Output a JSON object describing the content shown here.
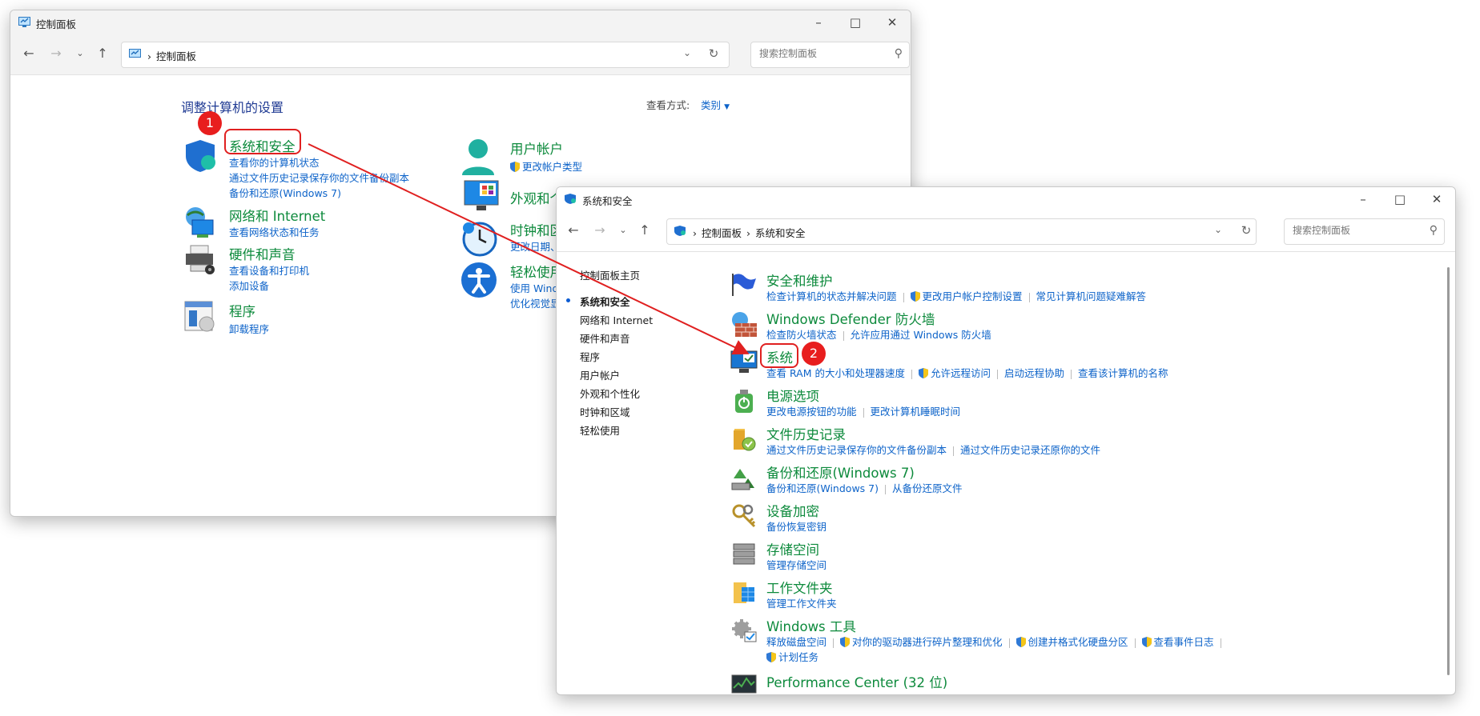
{
  "colors": {
    "accent": "#0d63c9",
    "category_green": "#0d8a3c",
    "heading_blue": "#1f3a93",
    "annotation_red": "#e02020"
  },
  "back_window": {
    "title": "控制面板",
    "breadcrumb": [
      "控制面板"
    ],
    "search_placeholder": "搜索控制面板",
    "heading": "调整计算机的设置",
    "view_by_label": "查看方式:",
    "view_by_value": "类别",
    "categories": [
      {
        "title": "系统和安全",
        "icon": "shield-icon",
        "links": [
          "查看你的计算机状态",
          "通过文件历史记录保存你的文件备份副本",
          "备份和还原(Windows 7)"
        ]
      },
      {
        "title": "网络和 Internet",
        "icon": "network-globe-icon",
        "links": [
          "查看网络状态和任务"
        ]
      },
      {
        "title": "硬件和声音",
        "icon": "printer-icon",
        "links": [
          "查看设备和打印机",
          "添加设备"
        ]
      },
      {
        "title": "程序",
        "icon": "programs-icon",
        "links": [
          "卸载程序"
        ]
      },
      {
        "title": "用户帐户",
        "icon": "user-icon",
        "links": [
          "更改帐户类型"
        ]
      },
      {
        "title": "外观和个",
        "icon": "appearance-icon",
        "links": []
      },
      {
        "title": "时钟和区",
        "icon": "clock-icon",
        "links": [
          "更改日期、"
        ]
      },
      {
        "title": "轻松使用",
        "icon": "accessibility-icon",
        "links": [
          "使用 Wind",
          "优化视觉显"
        ]
      }
    ]
  },
  "front_window": {
    "title": "系统和安全",
    "breadcrumb": [
      "控制面板",
      "系统和安全"
    ],
    "search_placeholder": "搜索控制面板",
    "sidebar": [
      {
        "label": "控制面板主页",
        "active": false
      },
      {
        "label": "系统和安全",
        "active": true
      },
      {
        "label": "网络和 Internet",
        "active": false
      },
      {
        "label": "硬件和声音",
        "active": false
      },
      {
        "label": "程序",
        "active": false
      },
      {
        "label": "用户帐户",
        "active": false
      },
      {
        "label": "外观和个性化",
        "active": false
      },
      {
        "label": "时钟和区域",
        "active": false
      },
      {
        "label": "轻松使用",
        "active": false
      }
    ],
    "sections": [
      {
        "title": "安全和维护",
        "icon": "flag-icon",
        "links": [
          "检查计算机的状态并解决问题",
          "更改用户帐户控制设置",
          "常见计算机问题疑难解答"
        ]
      },
      {
        "title": "Windows Defender 防火墙",
        "icon": "firewall-icon",
        "links": [
          "检查防火墙状态",
          "允许应用通过 Windows 防火墙"
        ]
      },
      {
        "title": "系统",
        "icon": "system-monitor-icon",
        "links": [
          "查看 RAM 的大小和处理器速度",
          "允许远程访问",
          "启动远程协助",
          "查看该计算机的名称"
        ]
      },
      {
        "title": "电源选项",
        "icon": "power-icon",
        "links": [
          "更改电源按钮的功能",
          "更改计算机睡眠时间"
        ]
      },
      {
        "title": "文件历史记录",
        "icon": "file-history-icon",
        "links": [
          "通过文件历史记录保存你的文件备份副本",
          "通过文件历史记录还原你的文件"
        ]
      },
      {
        "title": "备份和还原(Windows 7)",
        "icon": "backup-icon",
        "links": [
          "备份和还原(Windows 7)",
          "从备份还原文件"
        ]
      },
      {
        "title": "设备加密",
        "icon": "keys-icon",
        "links": [
          "备份恢复密钥"
        ]
      },
      {
        "title": "存储空间",
        "icon": "storage-icon",
        "links": [
          "管理存储空间"
        ]
      },
      {
        "title": "工作文件夹",
        "icon": "work-folder-icon",
        "links": [
          "管理工作文件夹"
        ]
      },
      {
        "title": "Windows 工具",
        "icon": "tools-gear-icon",
        "links": [
          "释放磁盘空间",
          "对你的驱动器进行碎片整理和优化",
          "创建并格式化硬盘分区",
          "查看事件日志",
          "计划任务"
        ]
      },
      {
        "title": "Performance Center (32 位)",
        "icon": "performance-icon",
        "links": []
      }
    ]
  },
  "annotations": {
    "badge1": "1",
    "badge2": "2"
  }
}
